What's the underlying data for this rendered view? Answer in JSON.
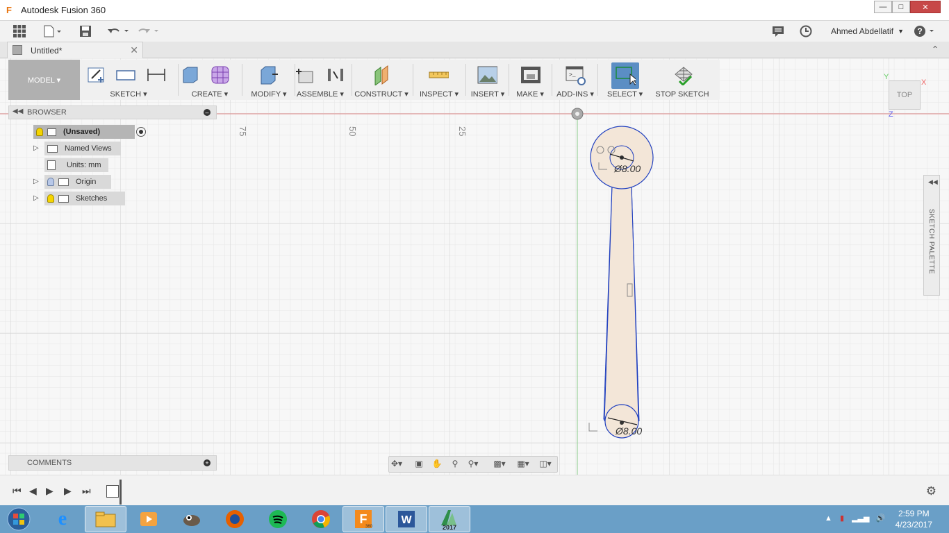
{
  "window": {
    "title": "Autodesk Fusion 360",
    "app_icon": "F"
  },
  "qat": {
    "user": "Ahmed Abdellatif",
    "help": "?"
  },
  "doc_tab": {
    "label": "Untitled*"
  },
  "toolbar": {
    "workspace": "MODEL ▾",
    "groups": [
      {
        "label": "SKETCH ▾"
      },
      {
        "label": "CREATE ▾"
      },
      {
        "label": "MODIFY ▾"
      },
      {
        "label": "ASSEMBLE ▾"
      },
      {
        "label": "CONSTRUCT ▾"
      },
      {
        "label": "INSPECT ▾"
      },
      {
        "label": "INSERT ▾"
      },
      {
        "label": "MAKE ▾"
      },
      {
        "label": "ADD-INS ▾"
      },
      {
        "label": "SELECT ▾"
      },
      {
        "label": "STOP SKETCH"
      }
    ]
  },
  "browser": {
    "title": "BROWSER",
    "root": "(Unsaved)",
    "items": [
      {
        "label": "Named Views"
      },
      {
        "label": "Units: mm"
      },
      {
        "label": "Origin"
      },
      {
        "label": "Sketches"
      }
    ]
  },
  "comments": {
    "title": "COMMENTS"
  },
  "canvas": {
    "ruler_labels": [
      "75",
      "50",
      "25"
    ],
    "dim_top": "Ø8.00",
    "dim_bottom": "Ø8.00",
    "viewcube": "TOP",
    "axis_x": "X",
    "axis_y": "Y",
    "axis_z": "Z"
  },
  "palette": {
    "label": "SKETCH PALETTE"
  },
  "clock": {
    "time": "2:59 PM",
    "date": "4/23/2017"
  },
  "taskbar": {
    "office_year": "2017",
    "fusion_badge": "360"
  },
  "colors": {
    "accent": "#5b8ec4",
    "sketch_line": "#1f3fbf",
    "profile_fill": "#f3e6d8",
    "taskbar": "#6a9fc7"
  }
}
